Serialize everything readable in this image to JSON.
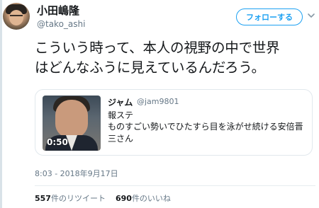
{
  "author": {
    "display_name": "小田嶋隆",
    "handle": "@tako_ashi"
  },
  "follow_button": {
    "label": "フォローする"
  },
  "tweet": {
    "line1": "こういう時って、本人の視野の中で世界",
    "line2": "はどんなふうに見えているんだろう。"
  },
  "quoted_tweet": {
    "author_name": "ジャム",
    "author_handle": "@jam9801",
    "line1": "報ステ",
    "line2": "ものすごい勢いでひたすら目を泳がせ続ける安倍晋三さん",
    "video_duration": "0:50"
  },
  "timestamp": "8:03 - 2018年9月17日",
  "stats": {
    "retweet_count": "557",
    "retweet_label": "件のリツイート",
    "like_count": "690",
    "like_label": "件のいいね"
  },
  "colors": {
    "accent": "#1da1f2",
    "secondary_text": "#657786",
    "primary_text": "#14171a"
  },
  "icons": {
    "menu": "chevron-down-icon",
    "video": "video-thumbnail"
  }
}
